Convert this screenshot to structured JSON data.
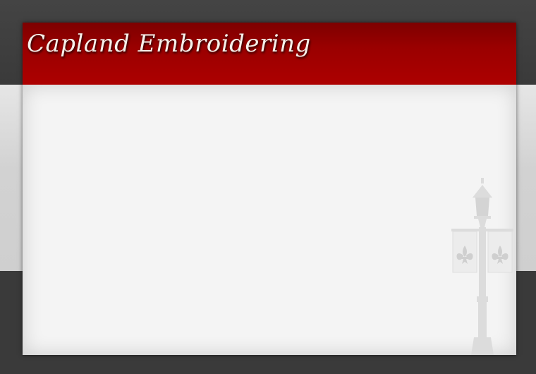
{
  "header": {
    "logo_text": "Capland Embroidering",
    "background_color": "#a00000",
    "text_color": "#f6f0ea"
  },
  "content": {
    "background_color": "#f4f4f4",
    "decoration": "lamppost-fleur-de-lis-icon"
  },
  "page": {
    "background_color": "#3d3d3d",
    "band_color": "#d8d8d8"
  }
}
